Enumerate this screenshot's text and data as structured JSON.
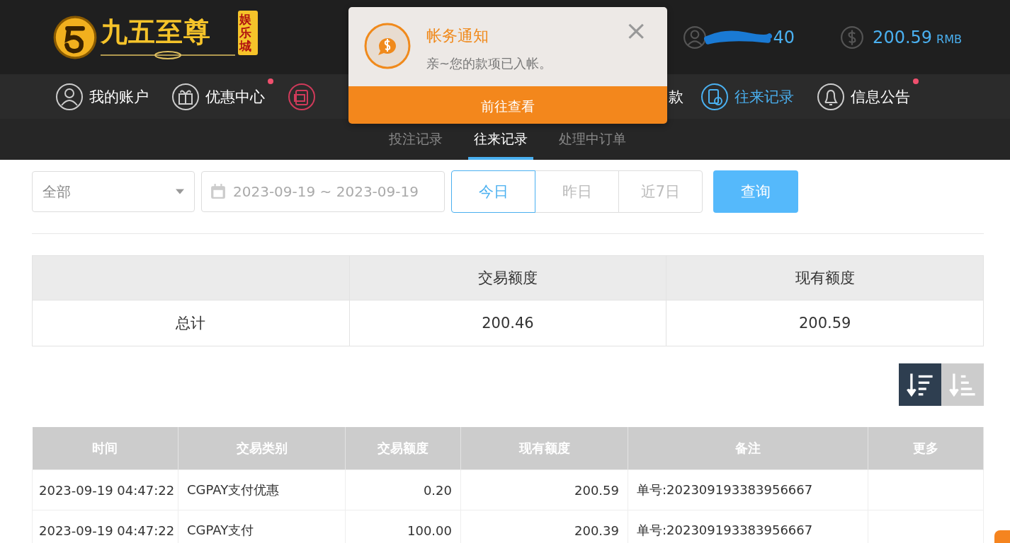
{
  "logo": {
    "name": "九五至尊",
    "badge": "娱乐城"
  },
  "account": {
    "username": "40",
    "balance": "200.59",
    "currency": "RMB"
  },
  "nav": [
    {
      "kind": "full",
      "label": "我的账户",
      "selected": false,
      "dot": false
    },
    {
      "kind": "full",
      "label": "优惠中心",
      "selected": false,
      "dot": true
    },
    {
      "kind": "icon_only"
    },
    {
      "kind": "tail",
      "label": "款"
    },
    {
      "kind": "full",
      "label": "往来记录",
      "selected": true,
      "dot": false
    },
    {
      "kind": "full",
      "label": "信息公告",
      "selected": false,
      "dot": true
    }
  ],
  "subtabs": [
    {
      "label": "投注记录",
      "selected": false
    },
    {
      "label": "往来记录",
      "selected": true
    },
    {
      "label": "处理中订单",
      "selected": false
    }
  ],
  "notification": {
    "title": "帐务通知",
    "message": "亲~您的款项已入帐。",
    "close": "×",
    "action": "前往查看"
  },
  "filters": {
    "type": "全部",
    "date_range": "2023-09-19 ~ 2023-09-19",
    "ranges": [
      {
        "label": "今日",
        "selected": true
      },
      {
        "label": "昨日",
        "selected": false
      },
      {
        "label": "近7日",
        "selected": false
      }
    ],
    "query": "查询"
  },
  "summary": {
    "columns": [
      "交易额度",
      "现有额度"
    ],
    "label": "总计",
    "values": [
      "200.46",
      "200.59"
    ]
  },
  "sort": [
    {
      "kind": "desc",
      "selected": true
    },
    {
      "kind": "asc",
      "selected": false
    }
  ],
  "table": {
    "columns": [
      "时间",
      "交易类别",
      "交易额度",
      "现有额度",
      "备注",
      "更多"
    ],
    "rows": [
      [
        "2023-09-19 04:47:22",
        "CGPAY支付优惠",
        "0.20",
        "200.59",
        "单号:202309193383956667"
      ],
      [
        "2023-09-19 04:47:22",
        "CGPAY支付",
        "100.00",
        "200.39",
        "单号:202309193383956667"
      ]
    ]
  }
}
